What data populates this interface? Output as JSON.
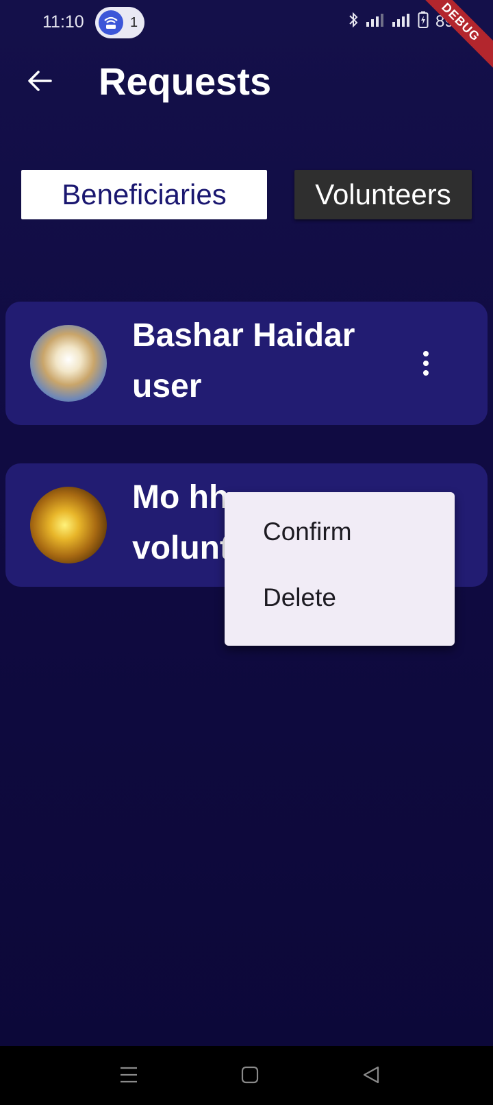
{
  "status_bar": {
    "time": "11:10",
    "hotspot_count": "1",
    "battery": "89%",
    "icons": [
      "bluetooth-icon",
      "signal-icon",
      "signal-icon",
      "battery-charging-icon"
    ]
  },
  "debug_banner": "DEBUG",
  "app_bar": {
    "title": "Requests",
    "back_icon": "arrow-left-icon"
  },
  "tabs": [
    {
      "label": "Beneficiaries",
      "selected": true
    },
    {
      "label": "Volunteers",
      "selected": false
    }
  ],
  "requests": [
    {
      "name": "Bashar Haidar",
      "role": "user"
    },
    {
      "name": "Mo hh",
      "role": "volunt"
    }
  ],
  "popup_menu": {
    "items": [
      {
        "label": "Confirm"
      },
      {
        "label": "Delete"
      }
    ]
  },
  "colors": {
    "background": "#120d46",
    "card": "#221c72",
    "tab_selected_bg": "#ffffff",
    "tab_selected_text": "#1a1770",
    "tab_unselected_bg": "#2f2f2f",
    "debug_banner": "#b3262d",
    "menu_bg": "#f1ecf6"
  }
}
